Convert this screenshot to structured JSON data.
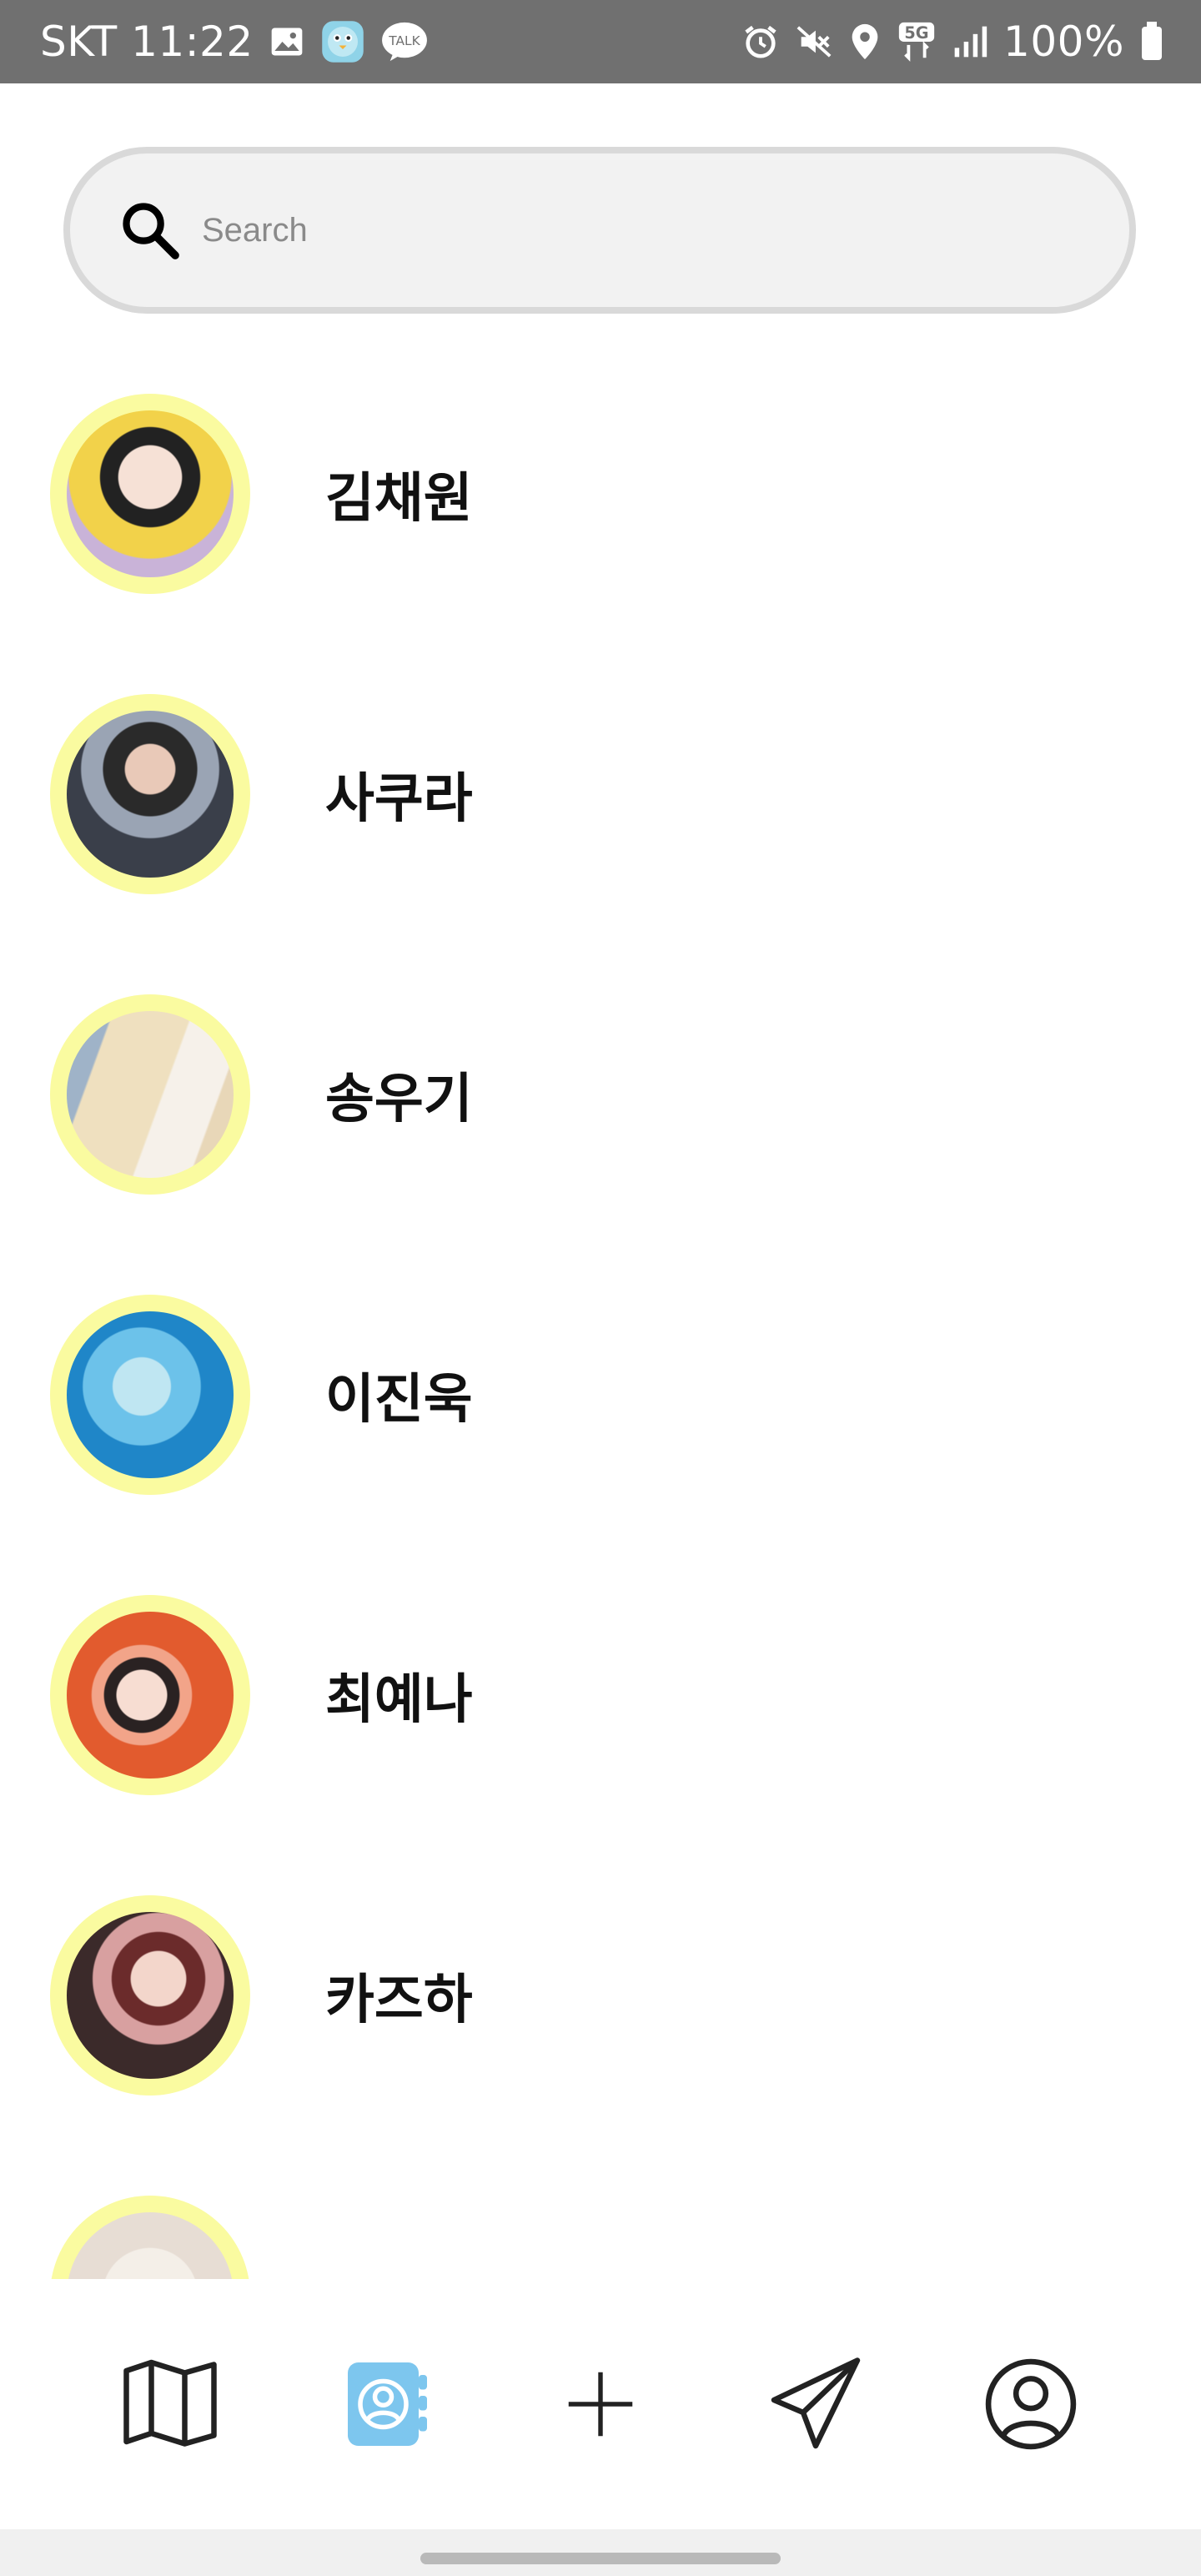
{
  "status_bar": {
    "carrier_time": "SKT 11:22",
    "network": "5G",
    "battery": "100%",
    "icons": [
      "gallery-icon",
      "bird-app-icon",
      "talk-icon",
      "alarm-icon",
      "mute-icon",
      "location-icon",
      "signal-icon",
      "battery-icon"
    ],
    "talk_label": "TALK"
  },
  "search": {
    "placeholder": "Search",
    "value": ""
  },
  "contacts": [
    {
      "name": "김채원",
      "avatar_colors": [
        "#f2d24a",
        "#c9b3d8"
      ]
    },
    {
      "name": "사쿠라",
      "avatar_colors": [
        "#3a3f4a",
        "#9aa4b4"
      ]
    },
    {
      "name": "송우기",
      "avatar_colors": [
        "#e8d7b8",
        "#9fb3c8"
      ]
    },
    {
      "name": "이진욱",
      "avatar_colors": [
        "#1f86c8",
        "#6cc2ea"
      ]
    },
    {
      "name": "최예나",
      "avatar_colors": [
        "#e25b2e",
        "#f2a489"
      ]
    },
    {
      "name": "카즈하",
      "avatar_colors": [
        "#5a3b3b",
        "#d8a0a0"
      ]
    },
    {
      "name": "",
      "avatar_colors": [
        "#e7ddd4",
        "#f4efe8"
      ]
    }
  ],
  "bottom_nav": {
    "items": [
      "map-icon",
      "contacts-book-icon",
      "add-icon",
      "send-icon",
      "profile-icon"
    ],
    "active": "contacts-book-icon",
    "active_color": "#7dc6ee",
    "icon_color": "#222222"
  },
  "colors": {
    "avatar_ring": "#fafba0",
    "status_bar_bg": "#707070",
    "search_bg": "#f2f2f2",
    "search_border": "#d9d9d9"
  }
}
